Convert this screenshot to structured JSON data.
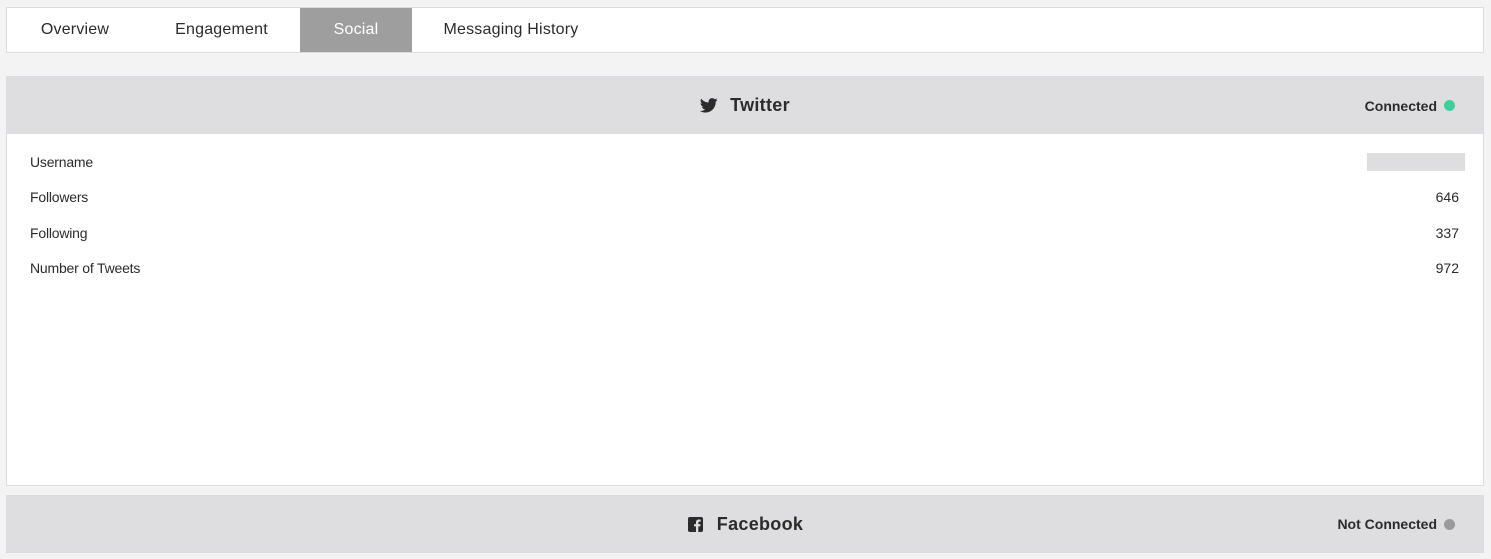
{
  "tabs": [
    {
      "label": "Overview"
    },
    {
      "label": "Engagement"
    },
    {
      "label": "Social"
    },
    {
      "label": "Messaging History"
    }
  ],
  "active_tab": "Social",
  "twitter": {
    "title": "Twitter",
    "icon": "twitter-icon",
    "status": "Connected",
    "status_color": "#3ecf9b",
    "rows": [
      {
        "label": "Username",
        "value": ""
      },
      {
        "label": "Followers",
        "value": "646"
      },
      {
        "label": "Following",
        "value": "337"
      },
      {
        "label": "Number of Tweets",
        "value": "972"
      }
    ]
  },
  "facebook": {
    "title": "Facebook",
    "icon": "facebook-icon",
    "status": "Not Connected",
    "status_color": "#9a9a9c"
  }
}
